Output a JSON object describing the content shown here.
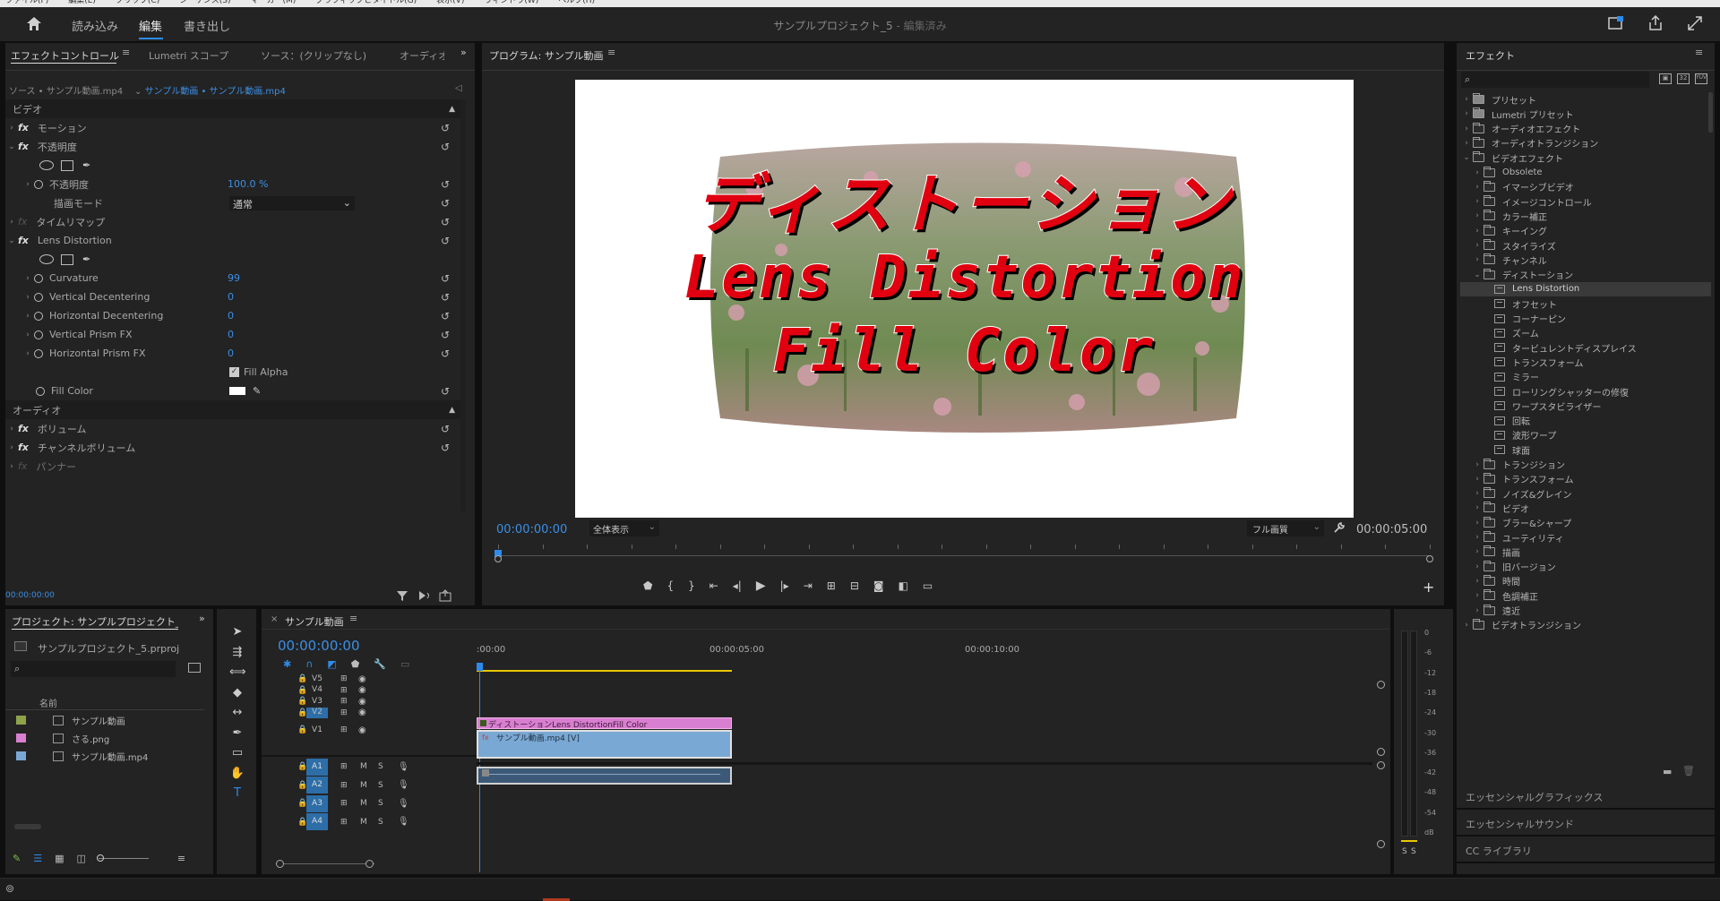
{
  "menubar": {
    "items": [
      "ファイル(F)",
      "編集(E)",
      "クリップ(C)",
      "シーケンス(S)",
      "マーカー(M)",
      "グラフィックとタイトル(G)",
      "表示(V)",
      "ウィンドウ(W)",
      "ヘルプ(H)"
    ]
  },
  "header": {
    "tabs": [
      "読み込み",
      "編集",
      "書き出し"
    ],
    "title": "サンプルプロジェクト_5",
    "title_suffix": " - 編集済み"
  },
  "effect_controls": {
    "tabs": [
      "エフェクトコントロール",
      "Lumetri スコープ",
      "ソース：(クリップなし)",
      "オーディオ"
    ],
    "source_label": "ソース • サンプル動画.mp4",
    "sequence_label": "サンプル動画 • サンプル動画.mp4",
    "video_header": "ビデオ",
    "audio_header": "オーディオ",
    "motion": "モーション",
    "opacity": "不透明度",
    "opacity_param": "不透明度",
    "opacity_value": "100.0 %",
    "blend_mode": "描画モード",
    "blend_value": "通常",
    "time_remap": "タイムリマップ",
    "lens": "Lens Distortion",
    "params": [
      {
        "name": "Curvature",
        "value": "99"
      },
      {
        "name": "Vertical Decentering",
        "value": "0"
      },
      {
        "name": "Horizontal Decentering",
        "value": "0"
      },
      {
        "name": "Vertical Prism FX",
        "value": "0"
      },
      {
        "name": "Horizontal Prism FX",
        "value": "0"
      }
    ],
    "fill_alpha": "Fill Alpha",
    "fill_color": "Fill Color",
    "volume": "ボリューム",
    "channel_volume": "チャンネルボリューム",
    "panner": "パンナー",
    "timecode": "00:00:00:00"
  },
  "program": {
    "title": "プログラム: サンプル動画",
    "timecode": "00:00:00:00",
    "fit": "全体表示",
    "quality": "フル画質",
    "duration": "00:00:05:00",
    "overlay_lines": [
      "ディストーション",
      "Lens Distortion",
      "Fill Color"
    ]
  },
  "effects_panel": {
    "title": "エフェクト",
    "items": [
      {
        "label": "プリセット",
        "level": 0,
        "open": false,
        "type": "special"
      },
      {
        "label": "Lumetri プリセット",
        "level": 0,
        "open": false,
        "type": "special"
      },
      {
        "label": "オーディオエフェクト",
        "level": 0,
        "open": false,
        "type": "folder"
      },
      {
        "label": "オーディオトランジション",
        "level": 0,
        "open": false,
        "type": "folder"
      },
      {
        "label": "ビデオエフェクト",
        "level": 0,
        "open": true,
        "type": "folder"
      },
      {
        "label": "Obsolete",
        "level": 1,
        "open": false,
        "type": "folder"
      },
      {
        "label": "イマーシブビデオ",
        "level": 1,
        "open": false,
        "type": "folder"
      },
      {
        "label": "イメージコントロール",
        "level": 1,
        "open": false,
        "type": "folder"
      },
      {
        "label": "カラー補正",
        "level": 1,
        "open": false,
        "type": "folder"
      },
      {
        "label": "キーイング",
        "level": 1,
        "open": false,
        "type": "folder"
      },
      {
        "label": "スタイライズ",
        "level": 1,
        "open": false,
        "type": "folder"
      },
      {
        "label": "チャンネル",
        "level": 1,
        "open": false,
        "type": "folder"
      },
      {
        "label": "ディストーション",
        "level": 1,
        "open": true,
        "type": "folder"
      },
      {
        "label": "Lens Distortion",
        "level": 2,
        "type": "fx",
        "selected": true
      },
      {
        "label": "オフセット",
        "level": 2,
        "type": "fx"
      },
      {
        "label": "コーナーピン",
        "level": 2,
        "type": "fx"
      },
      {
        "label": "ズーム",
        "level": 2,
        "type": "fx"
      },
      {
        "label": "タービュレントディスプレイス",
        "level": 2,
        "type": "fx"
      },
      {
        "label": "トランスフォーム",
        "level": 2,
        "type": "fx"
      },
      {
        "label": "ミラー",
        "level": 2,
        "type": "fx"
      },
      {
        "label": "ローリングシャッターの修復",
        "level": 2,
        "type": "fx"
      },
      {
        "label": "ワープスタビライザー",
        "level": 2,
        "type": "fx"
      },
      {
        "label": "回転",
        "level": 2,
        "type": "fx"
      },
      {
        "label": "波形ワープ",
        "level": 2,
        "type": "fx"
      },
      {
        "label": "球面",
        "level": 2,
        "type": "fx"
      },
      {
        "label": "トランジション",
        "level": 1,
        "open": false,
        "type": "folder"
      },
      {
        "label": "トランスフォーム",
        "level": 1,
        "open": false,
        "type": "folder"
      },
      {
        "label": "ノイズ&グレイン",
        "level": 1,
        "open": false,
        "type": "folder"
      },
      {
        "label": "ビデオ",
        "level": 1,
        "open": false,
        "type": "folder"
      },
      {
        "label": "ブラー&シャープ",
        "level": 1,
        "open": false,
        "type": "folder"
      },
      {
        "label": "ユーティリティ",
        "level": 1,
        "open": false,
        "type": "folder"
      },
      {
        "label": "描画",
        "level": 1,
        "open": false,
        "type": "folder"
      },
      {
        "label": "旧バージョン",
        "level": 1,
        "open": false,
        "type": "folder"
      },
      {
        "label": "時間",
        "level": 1,
        "open": false,
        "type": "folder"
      },
      {
        "label": "色調補正",
        "level": 1,
        "open": false,
        "type": "folder"
      },
      {
        "label": "遠近",
        "level": 1,
        "open": false,
        "type": "folder"
      },
      {
        "label": "ビデオトランジション",
        "level": 0,
        "open": false,
        "type": "folder"
      }
    ],
    "bottom": [
      "エッセンシャルグラフィックス",
      "エッセンシャルサウンド",
      "CC ライブラリ"
    ]
  },
  "project": {
    "title": "プロジェクト: サンプルプロジェクト_5",
    "file": "サンプルプロジェクト_5.prproj",
    "col_name": "名前",
    "items": [
      {
        "name": "サンプル動画",
        "color": "#8ea24a"
      },
      {
        "name": "さる.png",
        "color": "#d97fd0"
      },
      {
        "name": "サンプル動画.mp4",
        "color": "#7aa8d4"
      }
    ]
  },
  "timeline": {
    "tab": "サンプル動画",
    "timecode": "00:00:00:00",
    "ruler": [
      ":00:00",
      "00:00:05:00",
      "00:00:10:00"
    ],
    "video_tracks": [
      "V5",
      "V4",
      "V3",
      "V2",
      "V1"
    ],
    "audio_tracks": [
      "A1",
      "A2",
      "A3",
      "A4"
    ],
    "clip_title": "ディストーションLens DistortionFill Color",
    "clip_video": "サンプル動画.mp4 [V]",
    "m": "M",
    "s": "S"
  },
  "meter": {
    "scale": [
      "0",
      "-6",
      "-12",
      "-18",
      "-24",
      "-30",
      "-36",
      "-42",
      "-48",
      "-54",
      "dB"
    ],
    "solo": [
      "S",
      "S"
    ]
  },
  "colors": {
    "accent": "#2d8ceb",
    "clip_title": "#d97fd0",
    "clip_video": "#7aa8d4",
    "clip_audio": "#3c5a78"
  }
}
